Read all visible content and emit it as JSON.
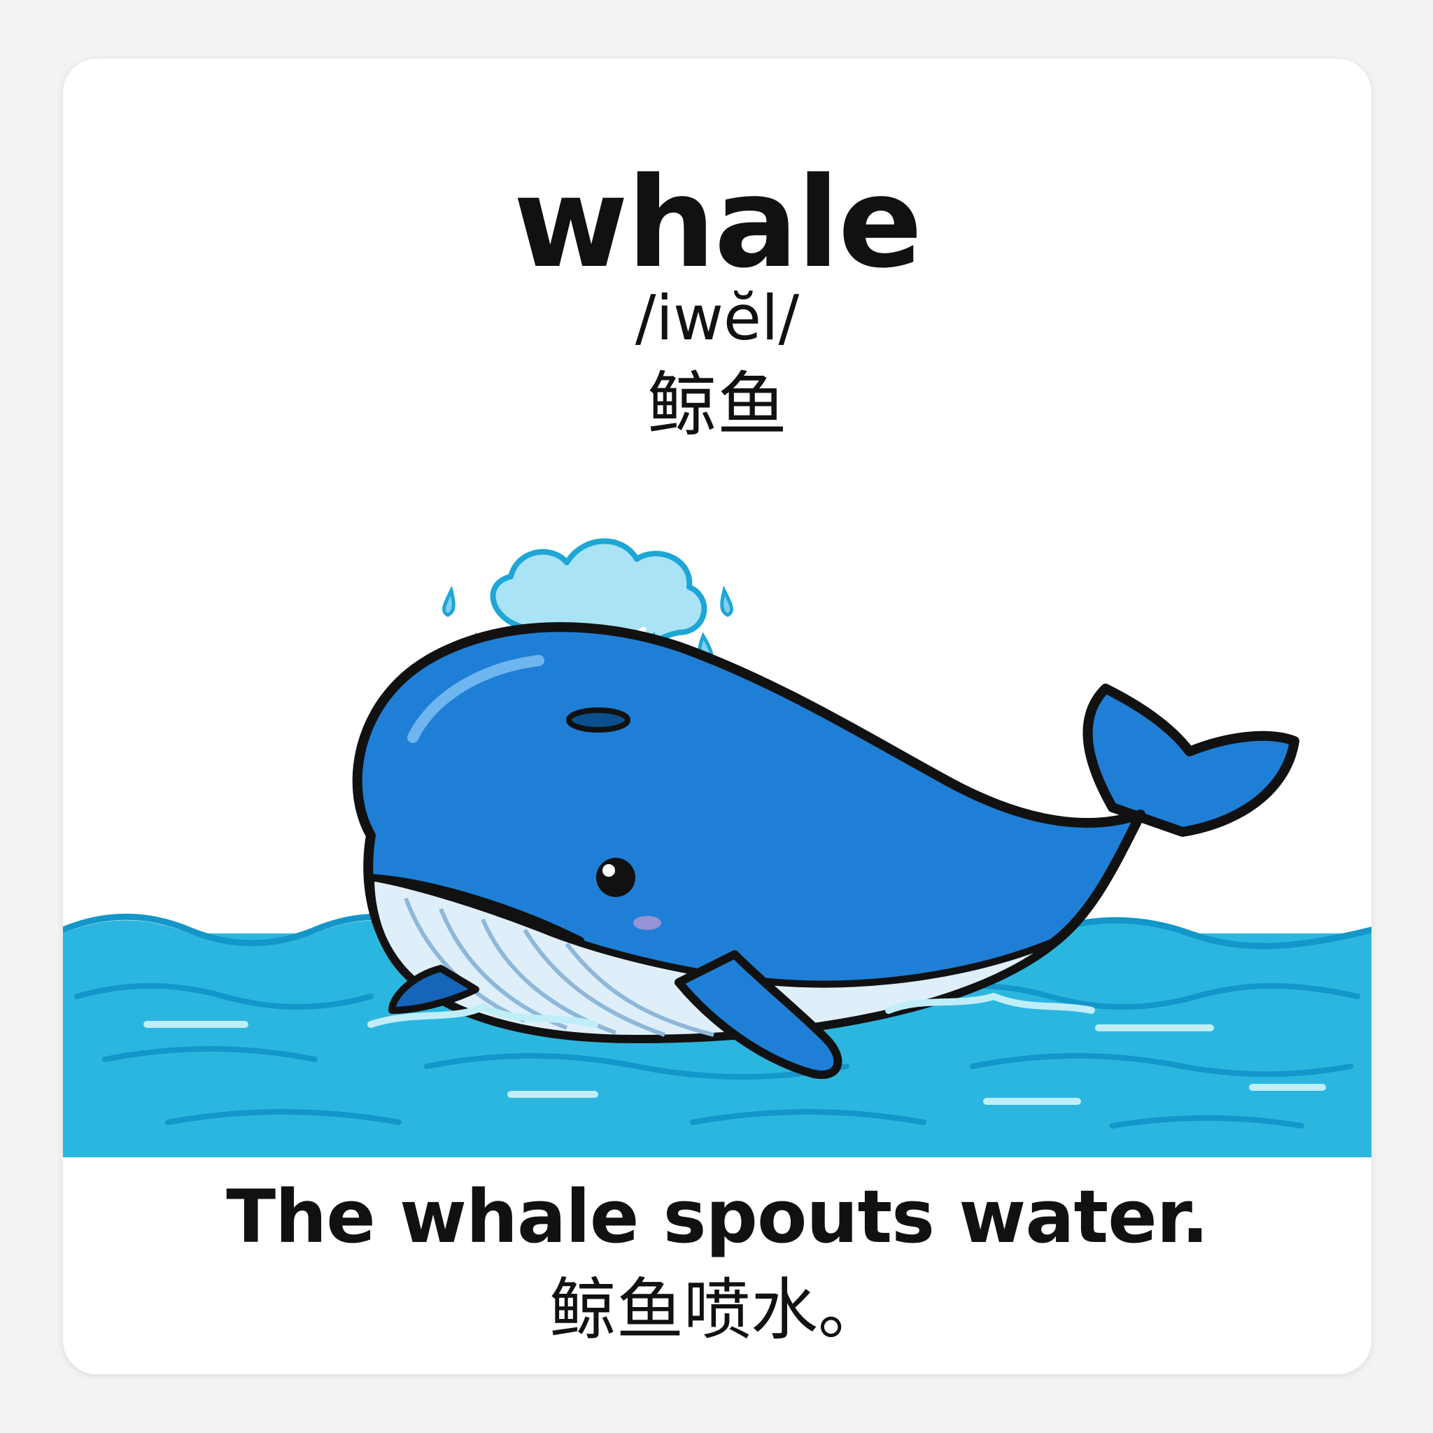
{
  "card": {
    "word": "whale",
    "phonetic": "/iwĕl/",
    "translation": "鲸鱼",
    "sentence": "The whale spouts water.",
    "sentence_translation": "鲸鱼喷水。"
  },
  "illustration": {
    "subject": "whale-icon",
    "water": "waves-icon",
    "spout": "water-spout-icon",
    "colors": {
      "whale_body": "#1f7fd6",
      "whale_belly": "#dfeff9",
      "outline": "#111111",
      "water": "#2bb6e0",
      "water_dark": "#1396c9",
      "spout": "#a9e3f5"
    }
  }
}
